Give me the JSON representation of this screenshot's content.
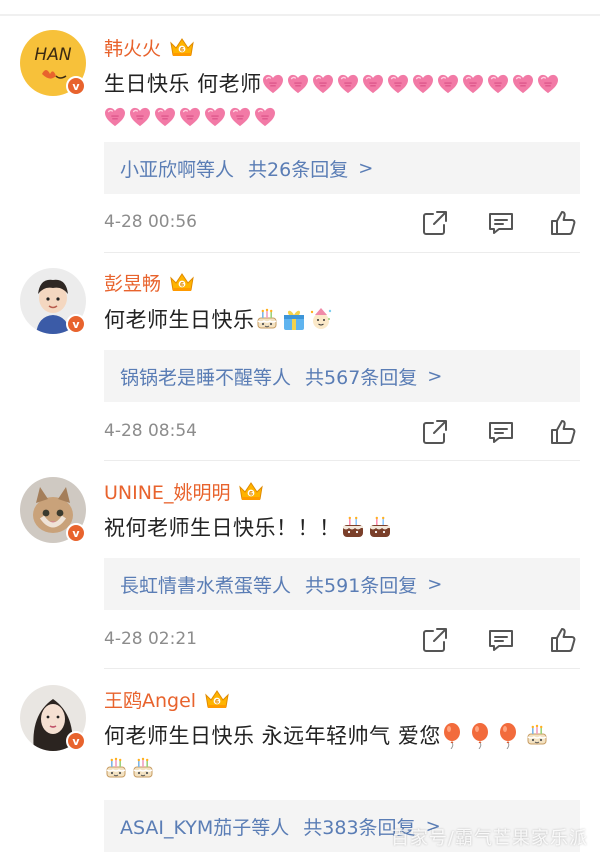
{
  "comments": [
    {
      "username": "韩火火",
      "text": "生日快乐 何老师",
      "reply_names": "小亚欣啊等人",
      "reply_count": "共26条回复",
      "reply_arrow": ">",
      "timestamp": "4-28 00:56",
      "avatar_text": "HAN",
      "emojis": [
        "heart",
        "heart",
        "heart",
        "heart",
        "heart",
        "heart",
        "heart",
        "heart",
        "heart",
        "heart",
        "heart",
        "heart",
        "heart",
        "heart",
        "heart",
        "heart",
        "heart",
        "heart",
        "heart"
      ]
    },
    {
      "username": "彭昱畅",
      "text": "何老师生日快乐",
      "reply_names": "锅锅老是睡不醒等人",
      "reply_count": "共567条回复",
      "reply_arrow": ">",
      "timestamp": "4-28 08:54",
      "emojis": [
        "cake",
        "gift",
        "party"
      ]
    },
    {
      "username": "UNINE_姚明明",
      "text": "祝何老师生日快乐！！！",
      "reply_names": "長虹情書水煮蛋等人",
      "reply_count": "共591条回复",
      "reply_arrow": ">",
      "timestamp": "4-28 02:21",
      "emojis": [
        "cake-choc",
        "cake-choc"
      ]
    },
    {
      "username": "王鸥Angel",
      "text": "何老师生日快乐 永远年轻帅气 爱您",
      "reply_names": "ASAI_KYM茄子等人",
      "reply_count": "共383条回复",
      "reply_arrow": ">",
      "emojis": [
        "balloon",
        "balloon",
        "balloon",
        "cake",
        "cake",
        "cake"
      ]
    }
  ],
  "icons": {
    "verified": "verified-v-badge",
    "crown": "crown-icon",
    "share": "share-icon",
    "comment": "comment-icon",
    "like": "thumbs-up-icon"
  },
  "colors": {
    "username": "#e8632d",
    "reply_link": "#5a7db5",
    "timestamp": "#8c8c8c",
    "reply_bg": "#f4f4f4"
  },
  "watermark": "百家号/霸气芒果家乐派"
}
